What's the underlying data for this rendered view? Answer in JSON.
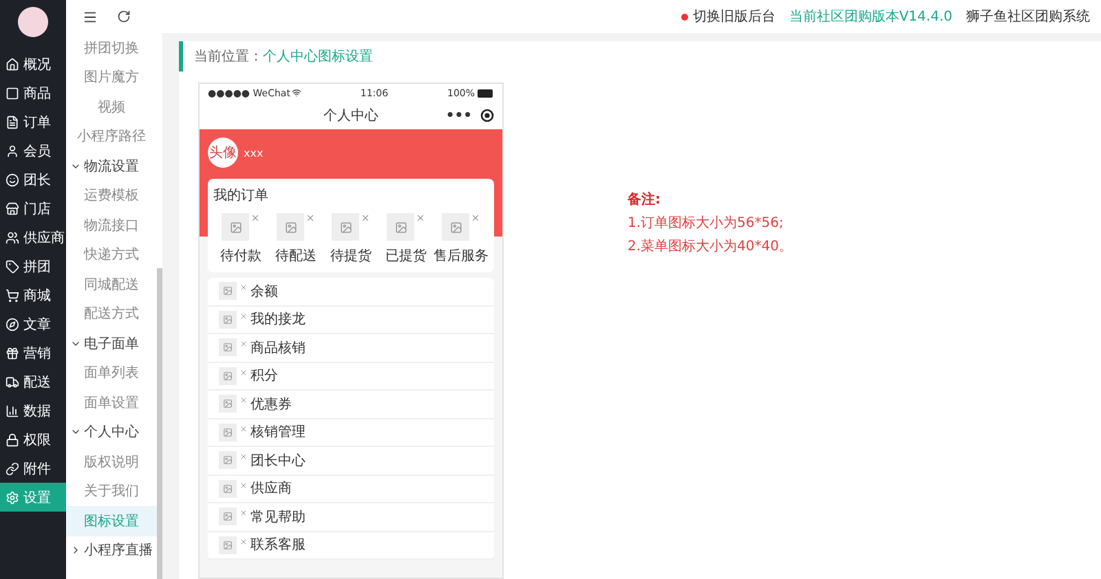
{
  "header": {
    "notice": "切换旧版后台",
    "version": "当前社区团购版本V14.4.0",
    "system": "狮子鱼社区团购系统"
  },
  "nav": [
    {
      "label": "概况",
      "selected": false
    },
    {
      "label": "商品",
      "selected": false
    },
    {
      "label": "订单",
      "selected": false
    },
    {
      "label": "会员",
      "selected": false
    },
    {
      "label": "团长",
      "selected": false
    },
    {
      "label": "门店",
      "selected": false
    },
    {
      "label": "供应商",
      "selected": false
    },
    {
      "label": "拼团",
      "selected": false
    },
    {
      "label": "商城",
      "selected": false
    },
    {
      "label": "文章",
      "selected": false
    },
    {
      "label": "营销",
      "selected": false
    },
    {
      "label": "配送",
      "selected": false
    },
    {
      "label": "数据",
      "selected": false
    },
    {
      "label": "权限",
      "selected": false
    },
    {
      "label": "附件",
      "selected": false
    },
    {
      "label": "设置",
      "selected": true
    }
  ],
  "submenu": [
    {
      "kind": "item",
      "label": "拼团切换",
      "selected": false
    },
    {
      "kind": "item",
      "label": "图片魔方",
      "selected": false
    },
    {
      "kind": "item",
      "label": "视频",
      "selected": false
    },
    {
      "kind": "item",
      "label": "小程序路径",
      "selected": false
    },
    {
      "kind": "group",
      "label": "物流设置",
      "expanded": true
    },
    {
      "kind": "item",
      "label": "运费模板",
      "selected": false
    },
    {
      "kind": "item",
      "label": "物流接口",
      "selected": false
    },
    {
      "kind": "item",
      "label": "快递方式",
      "selected": false
    },
    {
      "kind": "item",
      "label": "同城配送",
      "selected": false
    },
    {
      "kind": "item",
      "label": "配送方式",
      "selected": false
    },
    {
      "kind": "group",
      "label": "电子面单",
      "expanded": true
    },
    {
      "kind": "item",
      "label": "面单列表",
      "selected": false
    },
    {
      "kind": "item",
      "label": "面单设置",
      "selected": false
    },
    {
      "kind": "group",
      "label": "个人中心",
      "expanded": true
    },
    {
      "kind": "item",
      "label": "版权说明",
      "selected": false
    },
    {
      "kind": "item",
      "label": "关于我们",
      "selected": false
    },
    {
      "kind": "item",
      "label": "图标设置",
      "selected": true
    },
    {
      "kind": "group",
      "label": "小程序直播",
      "expanded": false
    }
  ],
  "breadcrumb": {
    "label": "当前位置：",
    "current": "个人中心图标设置"
  },
  "phone": {
    "carrier": "●●●●● WeChat",
    "time": "11:06",
    "battery": "100%",
    "title": "个人中心",
    "capsule": "•••",
    "avatar": "头像",
    "nickname": "xxx",
    "orders": {
      "title": "我的订单",
      "items": [
        "待付款",
        "待配送",
        "待提货",
        "已提货",
        "售后服务"
      ]
    },
    "menu": [
      "余额",
      "我的接龙",
      "商品核销",
      "积分",
      "优惠券",
      "核销管理",
      "团长中心",
      "供应商",
      "常见帮助",
      "联系客服"
    ]
  },
  "note": {
    "title": "备注:",
    "lines": [
      "1.订单图标大小为56*56;",
      "2.菜单图标大小为40*40。"
    ]
  }
}
